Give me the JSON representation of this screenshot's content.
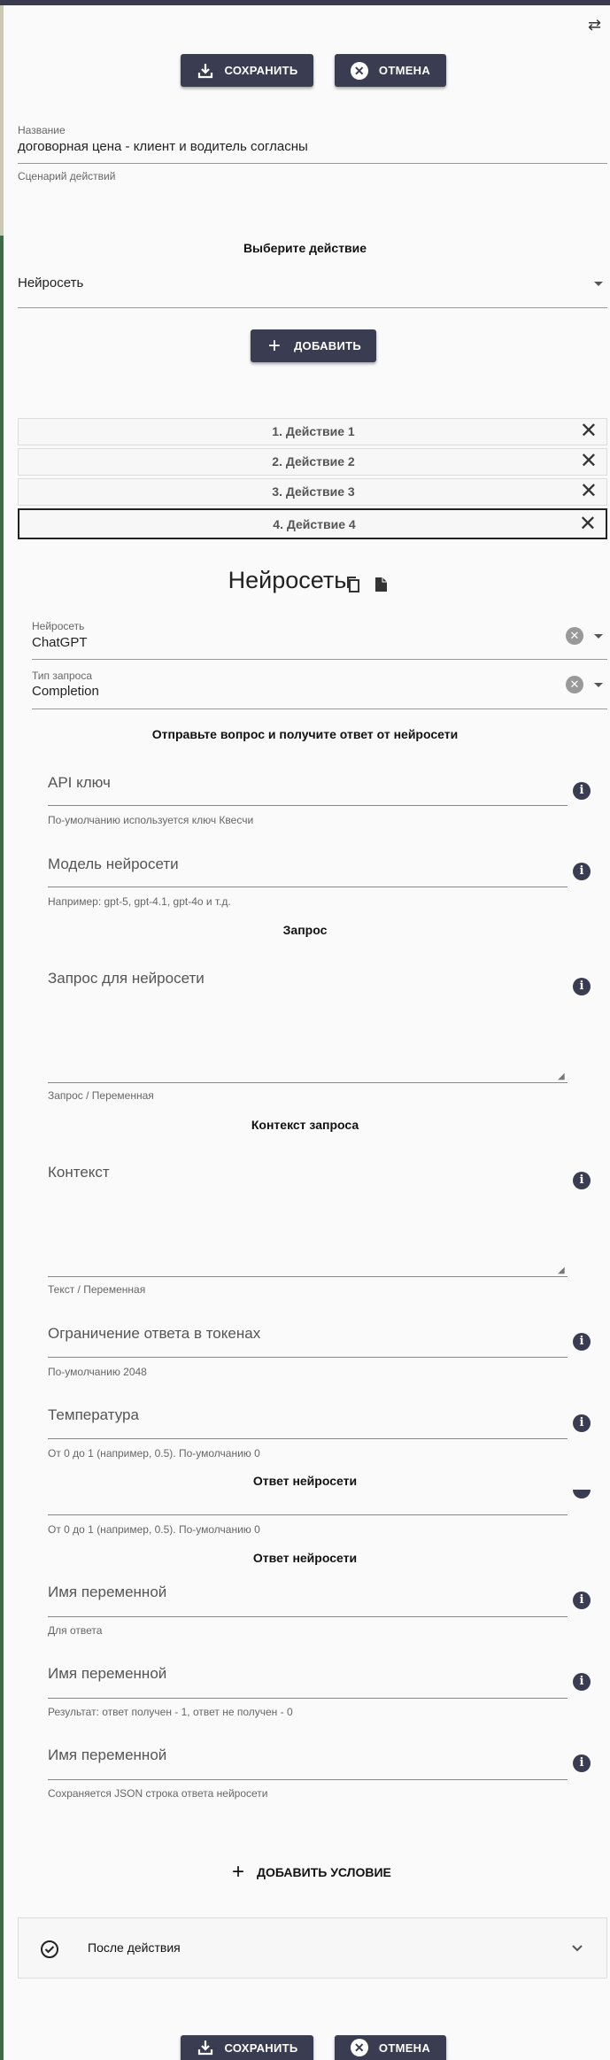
{
  "toolbar": {
    "save_label": "СОХРАНИТЬ",
    "cancel_label": "ОТМЕНА"
  },
  "form": {
    "name_label": "Название",
    "name_value": "договорная цена - клиент и водитель согласны",
    "scenario_label": "Сценарий действий",
    "choose_action_title": "Выберите действие",
    "action_select_value": "Нейросеть",
    "add_label": "ДОБАВИТЬ"
  },
  "actions": [
    {
      "label": "1. Действие 1"
    },
    {
      "label": "2. Действие 2"
    },
    {
      "label": "3. Действие 3"
    },
    {
      "label": "4. Действие 4"
    }
  ],
  "neural": {
    "title": "Нейросеть",
    "network_label": "Нейросеть",
    "network_value": "ChatGPT",
    "request_type_label": "Тип запроса",
    "request_type_value": "Completion",
    "section_title": "Отправьте вопрос и получите ответ от нейросети",
    "api_key_placeholder": "API ключ",
    "api_key_helper": "По-умолчанию используется ключ Квесчи",
    "model_placeholder": "Модель нейросети",
    "model_helper": "Например: gpt-5, gpt-4.1, gpt-4o и т.д.",
    "request_title": "Запрос",
    "request_placeholder": "Запрос для нейросети",
    "request_helper": "Запрос / Переменная",
    "context_title": "Контекст запроса",
    "context_placeholder": "Контекст",
    "context_helper": "Текст / Переменная",
    "tokens_placeholder": "Ограничение ответа в токенах",
    "tokens_helper": "По-умолчанию 2048",
    "temperature_placeholder": "Температура",
    "temperature_helper": "От 0 до 1 (например, 0.5). По-умолчанию 0",
    "response_title_overlap": "Ответ нейросети",
    "temperature_helper_dup": "От 0 до 1 (например, 0.5). По-умолчанию 0",
    "response_title": "Ответ нейросети",
    "var1_placeholder": "Имя переменной",
    "var1_helper": "Для ответа",
    "var2_placeholder": "Имя переменной",
    "var2_helper": "Результат: ответ получен - 1, ответ не получен - 0",
    "var3_placeholder": "Имя переменной",
    "var3_helper": "Сохраняется JSON строка ответа нейросети"
  },
  "add_condition_label": "ДОБАВИТЬ УСЛОВИЕ",
  "after_action_label": "После действия",
  "icons": {
    "swap": "swap-arrows-icon",
    "save": "download-icon",
    "cancel": "close-circle-icon",
    "copy": "copy-icon",
    "paste": "paste-icon",
    "info": "info-icon",
    "check": "check-circle-icon",
    "chevron": "chevron-down-icon"
  },
  "colors": {
    "button_bg": "#3a3c52",
    "info_bg": "#3a3c52"
  }
}
